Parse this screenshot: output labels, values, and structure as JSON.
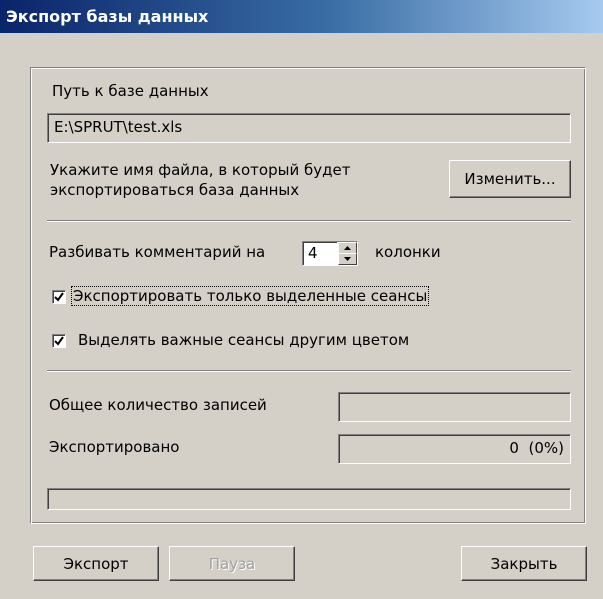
{
  "window": {
    "title": "Экспорт базы данных",
    "colors": {
      "face": "#d4d0c8",
      "title_start": "#0a246a",
      "title_end": "#a6caf0"
    }
  },
  "db_path": {
    "label": "Путь к базе данных",
    "value": "E:\\SPRUT\\test.xls"
  },
  "file_hint": {
    "line1": "Укажите имя файла, в который будет",
    "line2": "экспортироваться база данных"
  },
  "change_button": {
    "label": "Изменить..."
  },
  "split_comment": {
    "label_before": "Разбивать комментарий на",
    "value": "4",
    "label_after": "колонки"
  },
  "checkboxes": [
    {
      "label": "Экспортировать только выделенные сеансы",
      "checked": true,
      "focused": true
    },
    {
      "label": "Выделять важные сеансы другим цветом",
      "checked": true,
      "focused": false
    }
  ],
  "stats": {
    "total_label": "Общее количество записей",
    "total_value": "",
    "exported_label": "Экспортировано",
    "exported_value": "0  (0%)"
  },
  "progress": {
    "percent": 0
  },
  "buttons": {
    "export": "Экспорт",
    "pause": "Пауза",
    "close": "Закрыть"
  }
}
